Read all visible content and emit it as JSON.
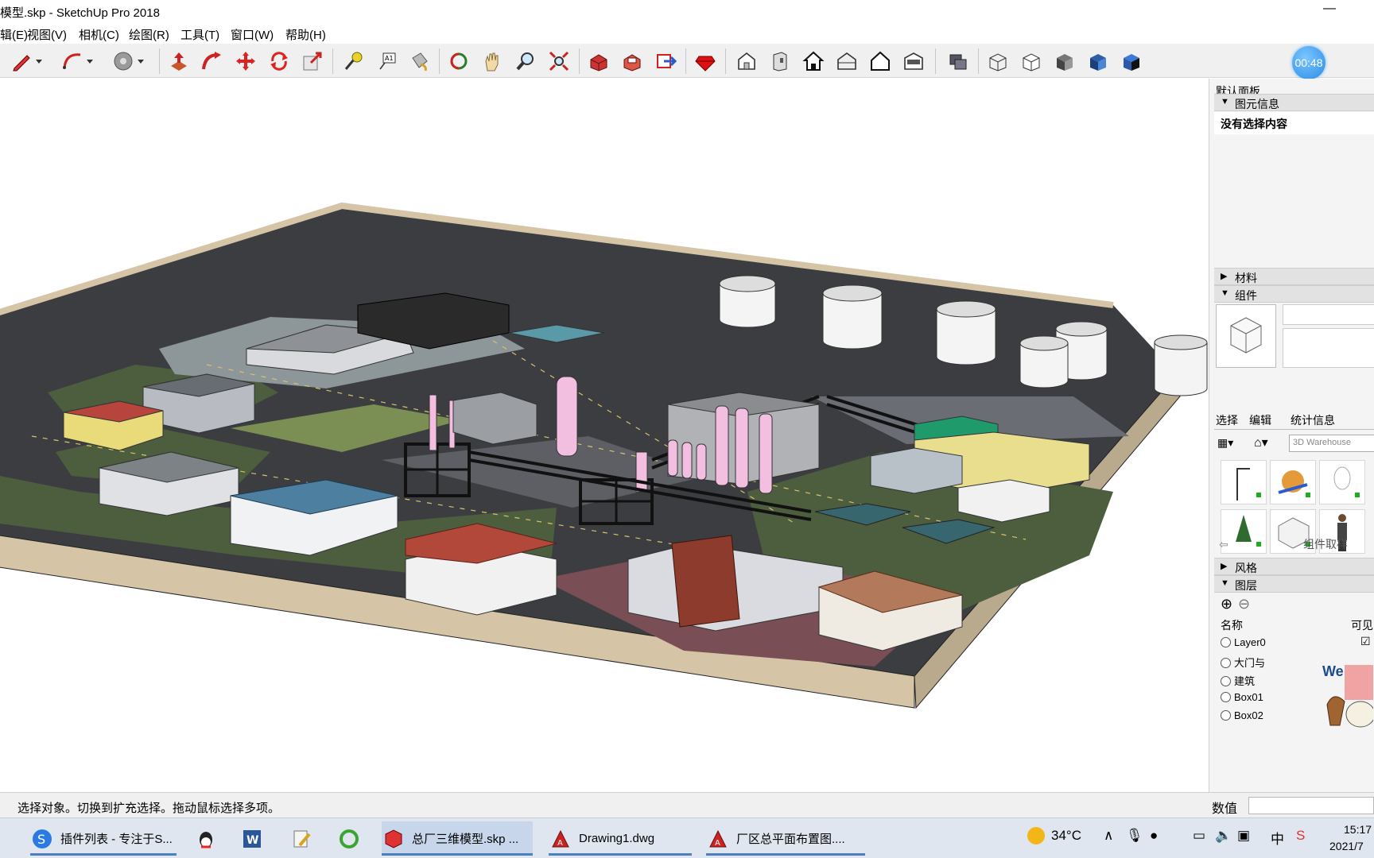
{
  "window": {
    "title": "模型.skp - SketchUp Pro 2018",
    "minimize_glyph": "—"
  },
  "menu": [
    "辑(E)",
    "视图(V)",
    "相机(C)",
    "绘图(R)",
    "工具(T)",
    "窗口(W)",
    "帮助(H)"
  ],
  "toolbar": {
    "icons": [
      "pencil-icon",
      "arc-icon",
      "paint-bucket-icon",
      "push-pull-icon",
      "follow-me-icon",
      "move-icon",
      "rotate-icon",
      "scale-icon",
      "tape-measure-icon",
      "text-icon",
      "paint-icon",
      "orbit-icon",
      "pan-icon",
      "zoom-icon",
      "zoom-extents-icon",
      "warehouse-icon",
      "extension-warehouse-icon",
      "send-to-layout-icon",
      "ruby-icon",
      "iso-view-icon",
      "front-view-icon",
      "right-view-icon",
      "back-view-icon",
      "left-view-icon",
      "top-view-icon",
      "xray-icon",
      "wireframe-icon",
      "hidden-line-icon",
      "shaded-icon",
      "shaded-textures-icon",
      "monochrome-icon"
    ],
    "timer": "00:48"
  },
  "tray": {
    "title": "默认面板",
    "entity_info": {
      "label": "图元信息",
      "content": "没有选择内容"
    },
    "materials": {
      "label": "材料"
    },
    "components": {
      "label": "组件",
      "tabs": [
        "选择",
        "编辑",
        "统计信息"
      ],
      "search_placeholder": "3D Warehouse",
      "sample_label": "组件取样"
    },
    "styles": {
      "label": "风格"
    },
    "layers": {
      "label": "图层",
      "col_name": "名称",
      "col_visible": "可见",
      "rows": [
        "Layer0",
        "大门与",
        "建筑",
        "Box01",
        "Box02"
      ]
    }
  },
  "status": {
    "message": "选择对象。切换到扩充选择。拖动鼠标选择多项。",
    "value_label": "数值"
  },
  "taskbar": {
    "tasks": [
      "插件列表 - 专注于S...",
      "总厂三维模型.skp ...",
      "Drawing1.dwg",
      "厂区总平面布置图...."
    ],
    "weather": "34°C",
    "ime": "中",
    "clock_time": "15:17",
    "clock_date": "2021/7"
  },
  "colors": {
    "ground": "#3f4044",
    "lawn": "#4d5e3f",
    "road_line": "#d9c36a",
    "tank": "#f4f4f4",
    "pink_tower": "#f3bfe0",
    "blue_roof": "#4d7fa0",
    "red_roof": "#b2483a",
    "accent": "#2b8be6"
  }
}
